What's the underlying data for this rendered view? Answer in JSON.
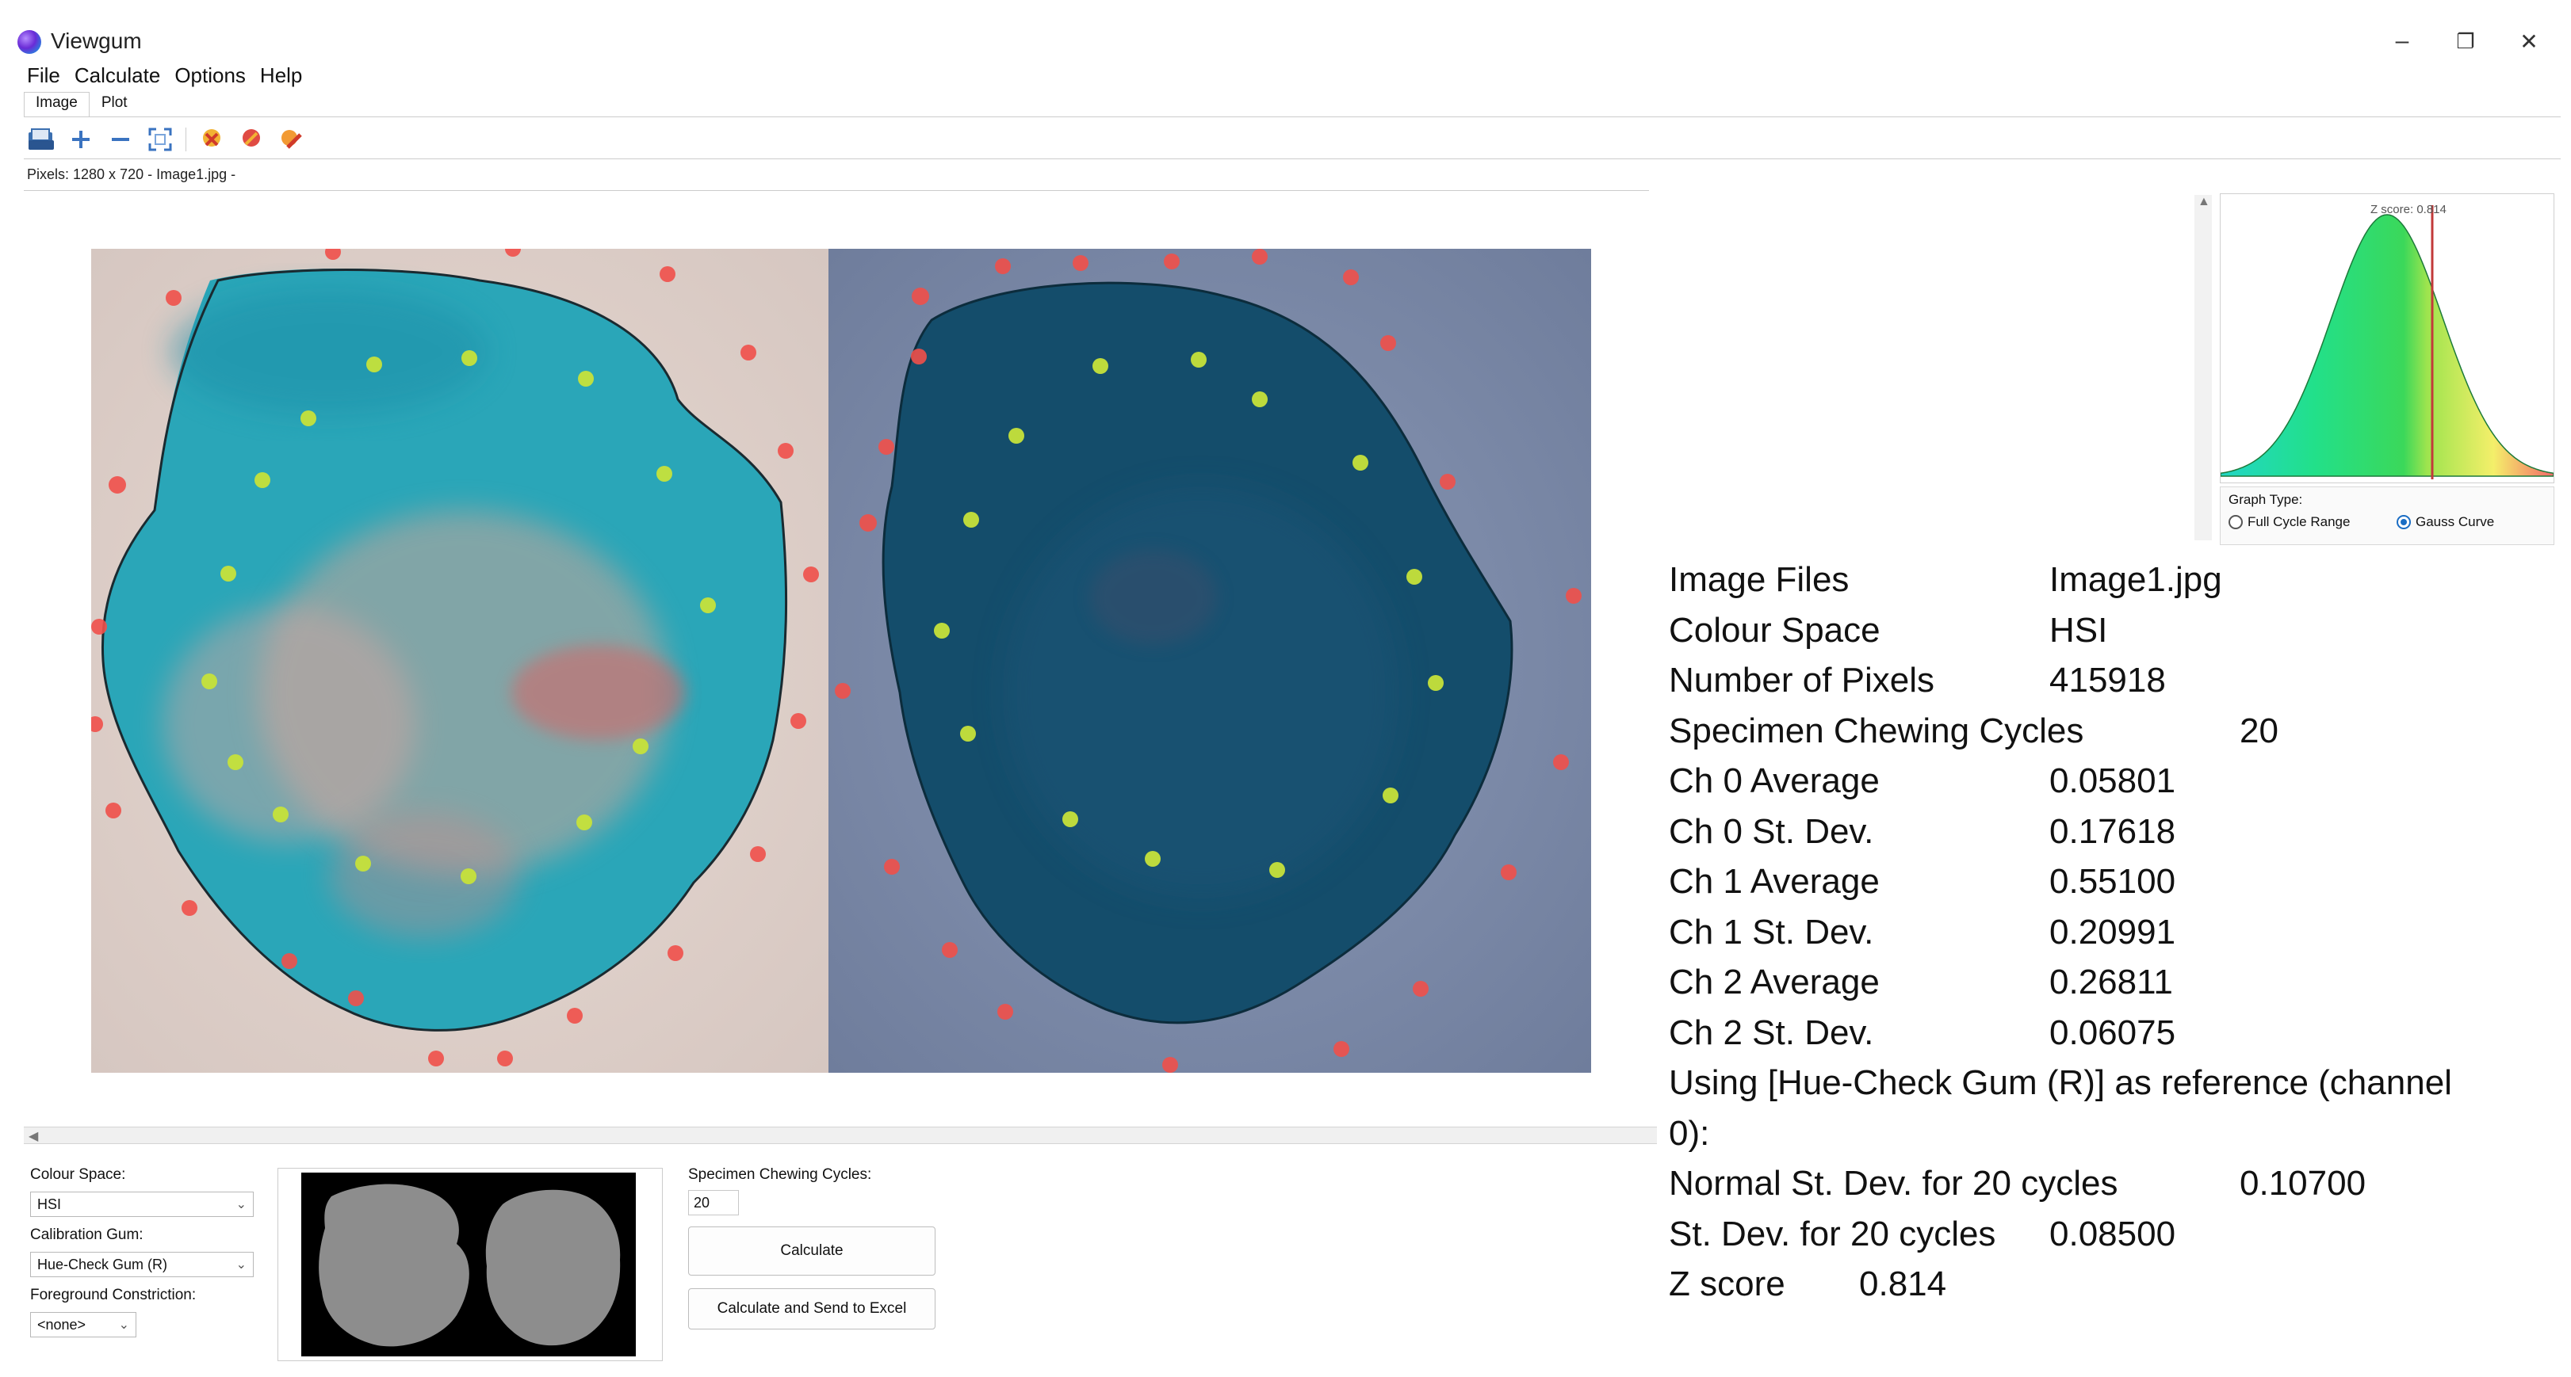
{
  "window": {
    "title": "Viewgum",
    "minimize": "–",
    "maximize": "❐",
    "close": "✕"
  },
  "menu": [
    "File",
    "Calculate",
    "Options",
    "Help"
  ],
  "tabs": [
    {
      "label": "Image",
      "active": true
    },
    {
      "label": "Plot",
      "active": false
    }
  ],
  "toolbar": {
    "icons": [
      "open-icon",
      "zoom-in-icon",
      "zoom-out-icon",
      "fit-icon",
      "clear-points-icon",
      "remove-point-icon",
      "edit-point-icon"
    ]
  },
  "pixel_info": "Pixels: 1280 x 720 - Image1.jpg -",
  "colors": {
    "red_point": "#f0504a",
    "green_point": "#c6e23a",
    "accent": "#1a6dc4"
  },
  "bottom": {
    "colour_space_label": "Colour Space:",
    "colour_space_value": "HSI",
    "calibration_label": "Calibration Gum:",
    "calibration_value": "Hue-Check Gum (R)",
    "foreground_label": "Foreground Constriction:",
    "foreground_value": "<none>",
    "cycles_label": "Specimen Chewing Cycles:",
    "cycles_value": "20",
    "calculate_button": "Calculate",
    "send_excel_button": "Calculate and Send to Excel"
  },
  "graph": {
    "zscore_label": "Z score: 0.814",
    "zscore": 0.814,
    "graph_type_label": "Graph Type:",
    "options": [
      {
        "label": "Full Cycle Range",
        "selected": false
      },
      {
        "label": "Gauss Curve",
        "selected": true
      }
    ]
  },
  "results": {
    "rows": [
      {
        "label": "Image Files",
        "value": "Image1.jpg"
      },
      {
        "label": "Colour Space",
        "value": "HSI"
      },
      {
        "label": "Number of Pixels",
        "value": "415918"
      },
      {
        "label": "Specimen Chewing Cycles",
        "value": "20"
      },
      {
        "label": "Ch 0 Average",
        "value": "0.05801"
      },
      {
        "label": "Ch 0 St. Dev.",
        "value": "0.17618"
      },
      {
        "label": "Ch 1 Average",
        "value": "0.55100"
      },
      {
        "label": "Ch 1 St. Dev.",
        "value": "0.20991"
      },
      {
        "label": "Ch 2 Average",
        "value": "0.26811"
      },
      {
        "label": "Ch 2 St. Dev.",
        "value": "0.06075"
      }
    ],
    "reference_line1": "Using [Hue-Check Gum (R)] as reference (channel",
    "reference_line2": "0):",
    "normal_label": "Normal St. Dev. for 20 cycles",
    "normal_value": "0.10700",
    "stdev_label": "St. Dev. for 20 cycles",
    "stdev_value": "0.08500",
    "z_label": "Z score",
    "z_value": "0.814"
  }
}
